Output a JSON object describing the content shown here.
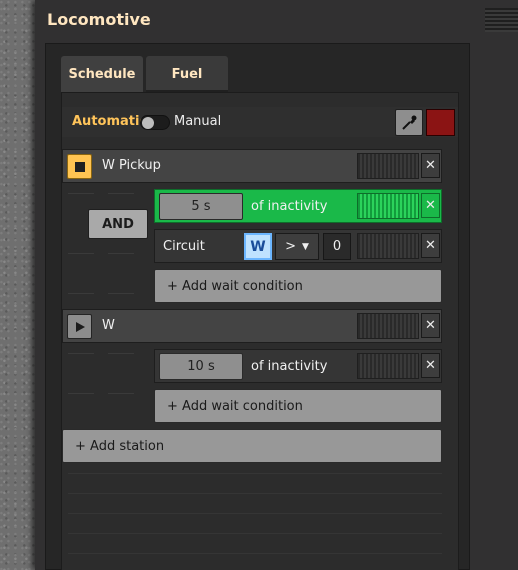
{
  "window": {
    "title": "Locomotive"
  },
  "tabs": [
    {
      "label": "Schedule",
      "active": true
    },
    {
      "label": "Fuel",
      "active": false
    }
  ],
  "mode": {
    "automatic_label": "Automatic",
    "manual_label": "Manual",
    "color": "#8b1414"
  },
  "stations": [
    {
      "name": "W Pickup",
      "state": "stop-icon",
      "conditions": [
        {
          "time": "5 s",
          "text": "of inactivity",
          "active": true
        },
        {
          "type": "Circuit",
          "signal": "W",
          "comparator": ">",
          "value": "0"
        }
      ],
      "connector": "AND",
      "add_condition_label": "+ Add wait condition"
    },
    {
      "name": "W",
      "state": "play-icon",
      "conditions": [
        {
          "time": "10 s",
          "text": "of inactivity",
          "active": false
        }
      ],
      "add_condition_label": "+ Add wait condition"
    }
  ],
  "add_station_label": "+ Add station",
  "colors": {
    "active_green": "#1ab949",
    "accent_orange": "#ffc45a",
    "title": "#ffe6c0"
  }
}
